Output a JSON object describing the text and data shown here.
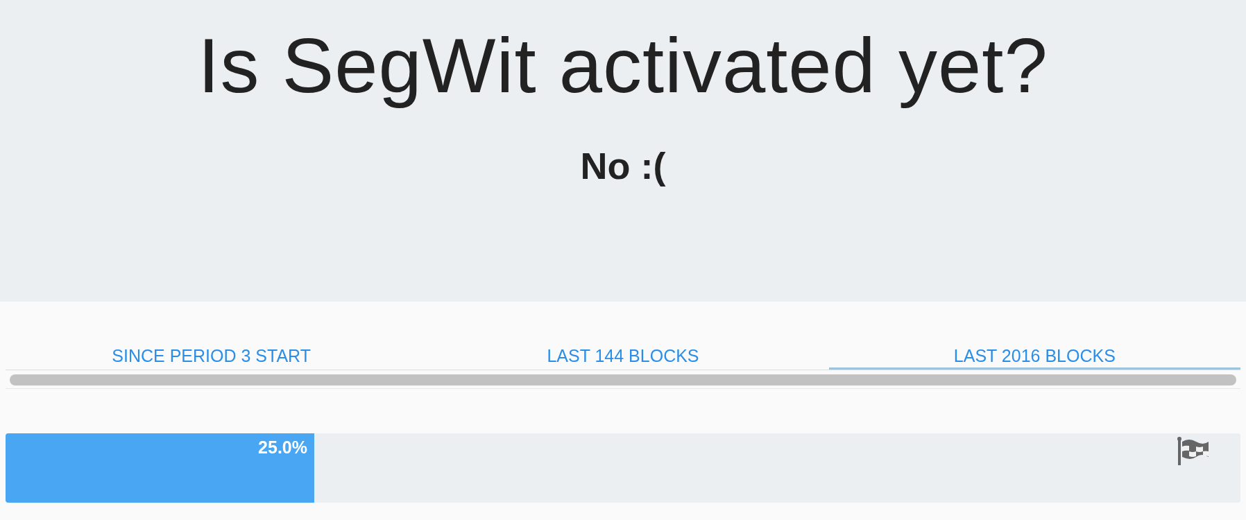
{
  "header": {
    "title": "Is SegWit activated yet?",
    "answer": "No :("
  },
  "tabs": [
    {
      "label": "SINCE PERIOD 3 START",
      "selected": false
    },
    {
      "label": "LAST 144 BLOCKS",
      "selected": false
    },
    {
      "label": "LAST 2016 BLOCKS",
      "selected": true
    }
  ],
  "progress": {
    "level": 0.25,
    "reading": "25.0%"
  }
}
